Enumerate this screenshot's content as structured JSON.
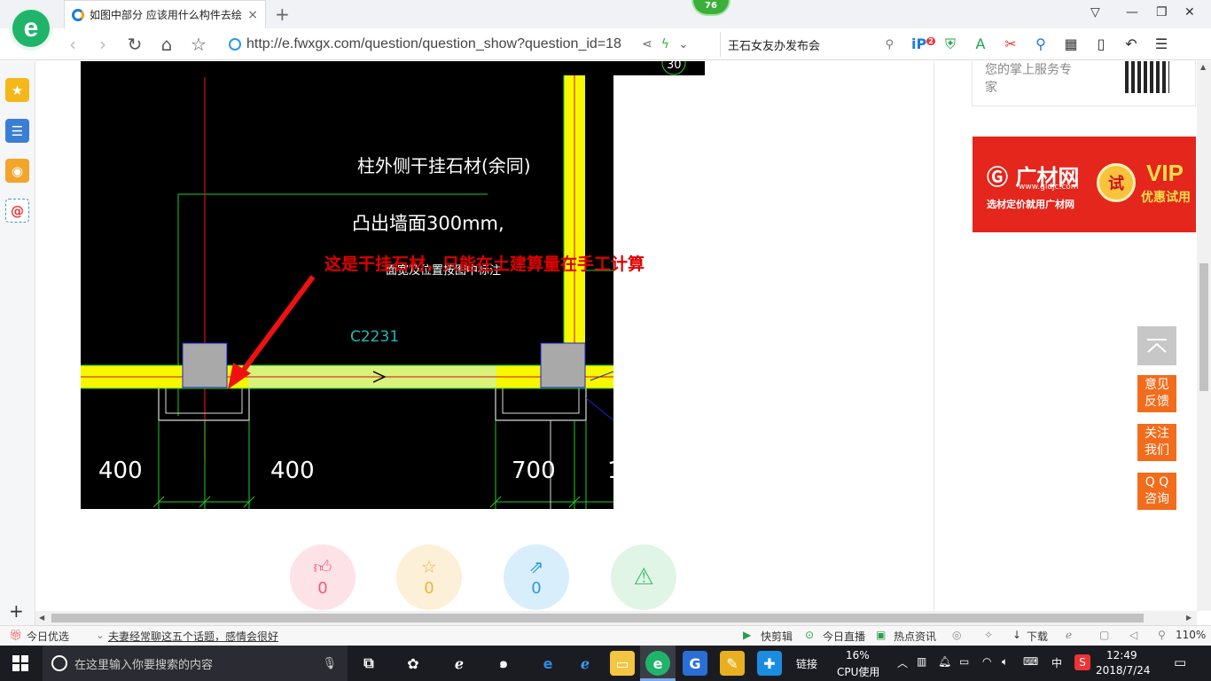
{
  "browser": {
    "tab_title": "如图中部分 应该用什么构件去绘",
    "tab_close": "×",
    "new_tab": "+",
    "badge": "76",
    "url": "http://e.fwxgx.com/question/question_show?question_id=18",
    "search_text": "王石女友办发布会",
    "tool_badge": "2",
    "icons": [
      "back-arrow",
      "forward-arrow",
      "refresh",
      "home",
      "star",
      "share",
      "bolt",
      "search",
      "ie-plugin",
      "shield",
      "translate",
      "scissors",
      "magnifier",
      "grid",
      "phone",
      "undo",
      "menu"
    ]
  },
  "sidebar": {
    "icons": [
      "favorites-star-icon",
      "reading-list-icon",
      "weibo-icon",
      "email-icon"
    ],
    "add": "+"
  },
  "cad": {
    "cn_line1": "柱外侧干挂石材(余同)",
    "cn_line2": "凸出墙面300mm,",
    "cn_line3": "面宽及位置按图中标注",
    "label_c": "C2231",
    "dim_1": "400",
    "dim_2": "400",
    "dim_3": "700",
    "dim_4": "1",
    "top_circle": "30"
  },
  "annotation": "这是干挂石材，只能在土建算量在手工计算",
  "actions": [
    {
      "name": "like",
      "count": "0",
      "color": "#f25b7a",
      "bg": "#fde3e8"
    },
    {
      "name": "favorite",
      "count": "0",
      "color": "#f1b33b",
      "bg": "#fdf0d8"
    },
    {
      "name": "share",
      "count": "0",
      "color": "#2b9be0",
      "bg": "#d9eefb"
    },
    {
      "name": "report",
      "count": "",
      "color": "#3fbf6a",
      "bg": "#e0f5e6"
    }
  ],
  "right": {
    "app_promo_line1": "您的掌上服务专",
    "app_promo_line2": "家",
    "ad_brand": "广材网",
    "ad_url": "www.gldjc.com",
    "ad_slogan": "选材定价就用广材网",
    "ad_try": "试",
    "ad_vip": "VIP",
    "ad_vip_sub": "优惠试用"
  },
  "float_buttons": [
    {
      "line1": "意见",
      "line2": "反馈"
    },
    {
      "line1": "关注",
      "line2": "我们"
    },
    {
      "line1": "Q Q",
      "line2": "咨询"
    }
  ],
  "statusbar": {
    "today_pick": "今日优选",
    "news": "夫妻经常聊这五个话题，感情会很好",
    "quick_cut": "快剪辑",
    "live": "今日直播",
    "hot_news": "热点资讯",
    "download": "下载",
    "zoom": "110%"
  },
  "taskbar": {
    "search_placeholder": "在这里输入你要搜索的内容",
    "link_label": "链接",
    "cpu_percent": "16%",
    "cpu_label": "CPU使用",
    "lang": "中",
    "time": "12:49",
    "date": "2018/7/24"
  }
}
